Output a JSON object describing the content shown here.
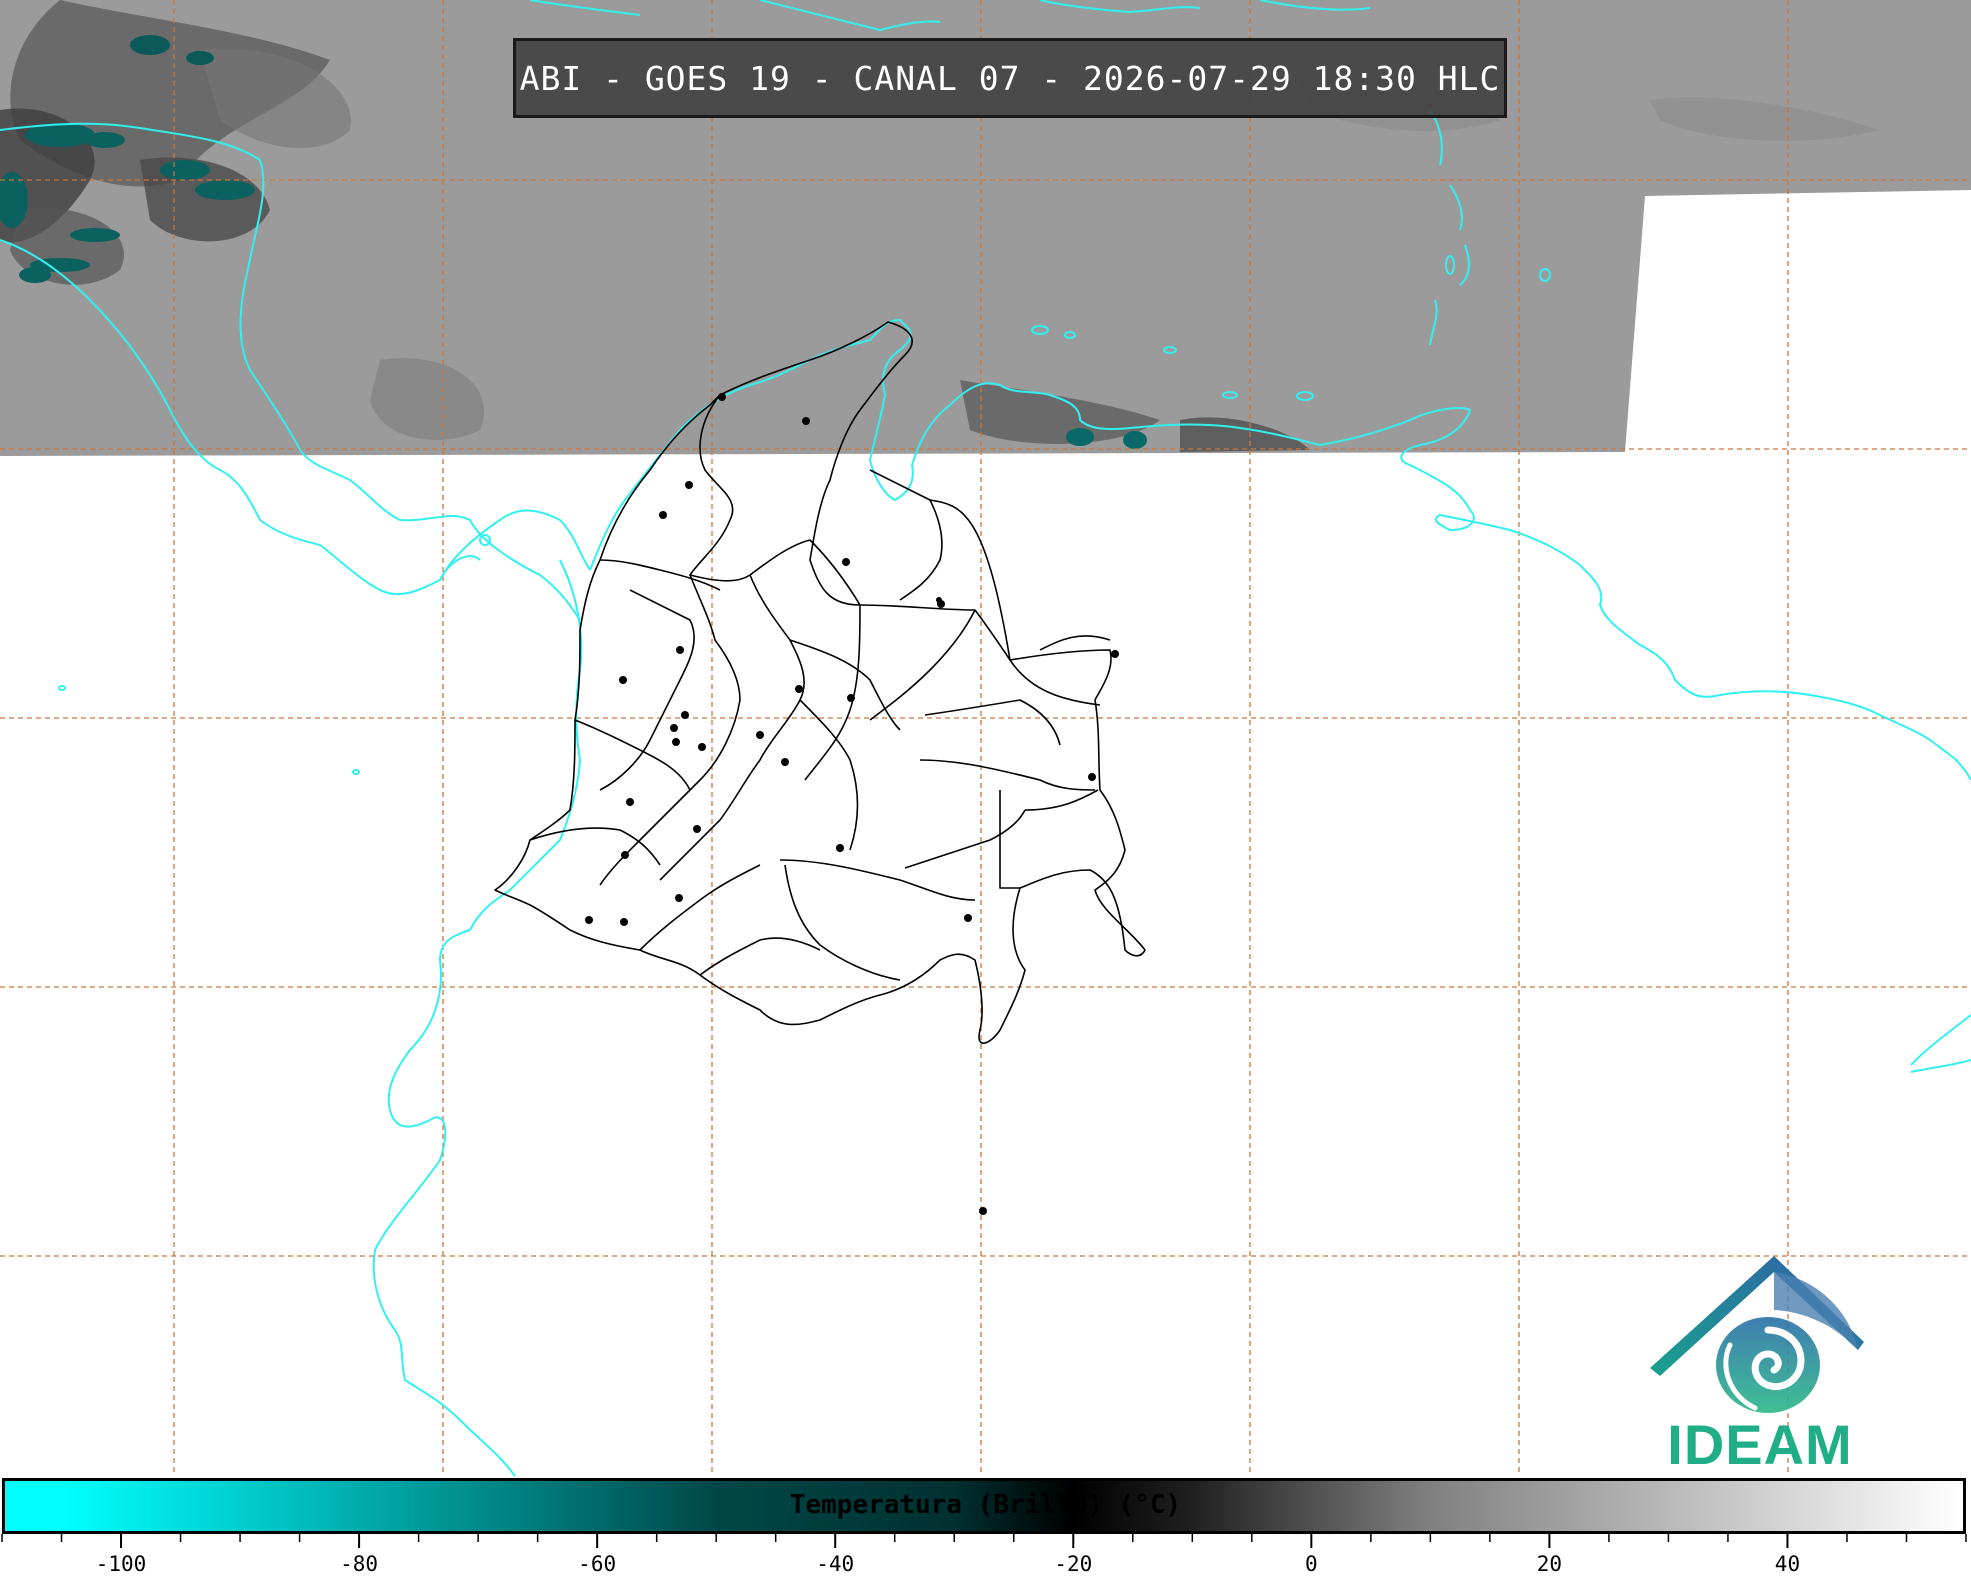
{
  "title": "ABI - GOES 19 - CANAL 07 - 2026-07-29 18:30 HLC",
  "logo": {
    "text": "IDEAM",
    "icon": "ideam-spiral-mountain-logo"
  },
  "colorbar": {
    "label": "Temperatura (Brillo) (°C)",
    "min": -110,
    "max": 55,
    "ticks": [
      "-100",
      "-80",
      "-60",
      "-40",
      "-20",
      "0",
      "20",
      "40"
    ],
    "tick_values": [
      -100,
      -80,
      -60,
      -40,
      -20,
      0,
      20,
      40
    ],
    "colors": {
      "cold": "#00ffff",
      "mid": "#004848",
      "black": "#000000",
      "warm": "#ffffff"
    }
  },
  "map": {
    "coastline_color": "#33f0f0",
    "border_color": "#000000",
    "grid_color": "#c8773a",
    "imagery_color": "#9a9a9a"
  }
}
